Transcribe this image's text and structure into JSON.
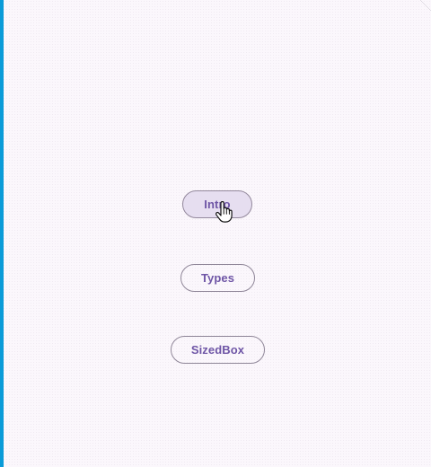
{
  "buttons": {
    "intro_label": "Intro",
    "types_label": "Types",
    "sizedbox_label": "SizedBox"
  },
  "colors": {
    "background": "#fbf7fc",
    "accent_text": "#6f56a6",
    "border": "#8f8698",
    "hover_fill": "#e6def0",
    "left_edge": "#0a9bd8"
  },
  "icons": {
    "cursor": "hand-pointer-icon"
  }
}
